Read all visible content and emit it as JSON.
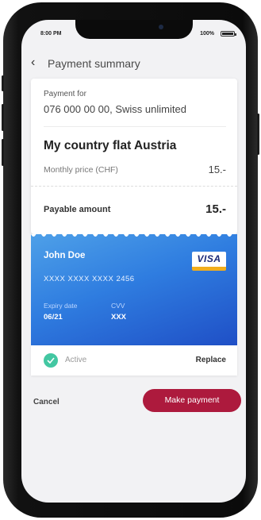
{
  "status_bar": {
    "time": "8:00 PM",
    "battery": "100%"
  },
  "header": {
    "back_icon": "chevron-left-icon",
    "title": "Payment summary"
  },
  "summary": {
    "payment_for_label": "Payment for",
    "payment_for_value": "076 000 00 00, Swiss unlimited",
    "plan_name": "My country flat Austria",
    "monthly_price_label": "Monthly price (CHF)",
    "monthly_price_value": "15.-",
    "payable_label": "Payable amount",
    "payable_value": "15.-"
  },
  "credit_card": {
    "holder": "John Doe",
    "number": "XXXX XXXX XXXX 2456",
    "expiry_label": "Expiry date",
    "expiry_value": "06/21",
    "cvv_label": "CVV",
    "cvv_value": "XXX",
    "brand": "VISA",
    "gradient_colors": [
      "#4ea0e8",
      "#2f7de0",
      "#1f4fc6"
    ]
  },
  "card_status": {
    "check_icon": "check-circle-icon",
    "status": "Active",
    "replace_label": "Replace",
    "check_color": "#43c7a2"
  },
  "actions": {
    "cancel_label": "Cancel",
    "pay_label": "Make payment",
    "pay_color": "#ad1a3d"
  }
}
